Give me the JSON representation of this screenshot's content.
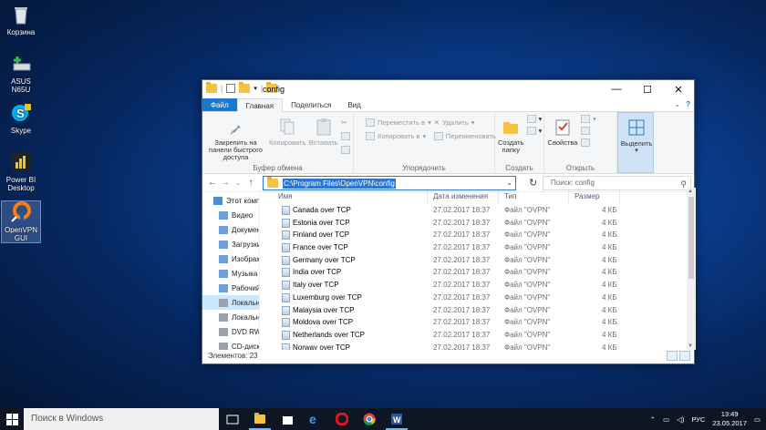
{
  "desktop": {
    "icons": [
      {
        "label": "Корзина",
        "icon": "recycle-bin-icon"
      },
      {
        "label": "ASUS N65U",
        "icon": "network-drive-icon"
      },
      {
        "label": "Skype",
        "icon": "skype-icon"
      },
      {
        "label": "Power BI Desktop",
        "icon": "power-bi-icon"
      },
      {
        "label": "OpenVPN GUI",
        "icon": "openvpn-icon"
      }
    ]
  },
  "window": {
    "title": "config",
    "minimize": "—",
    "maximize": "☐",
    "close": "✕"
  },
  "ribbon": {
    "tabs": {
      "file": "Файл",
      "home": "Главная",
      "share": "Поделиться",
      "view": "Вид"
    },
    "clipboard": {
      "pin": "Закрепить на панели быстрого доступа",
      "copy": "Копировать",
      "paste": "Вставить",
      "group": "Буфер обмена"
    },
    "organize": {
      "move_to": "Переместить в",
      "copy_to": "Копировать в",
      "delete": "Удалить",
      "rename": "Переименовать",
      "group": "Упорядочить"
    },
    "new": {
      "new_folder": "Создать папку",
      "group": "Создать"
    },
    "open": {
      "properties": "Свойства",
      "group": "Открыть"
    },
    "select": {
      "select": "Выделить"
    }
  },
  "address": {
    "path": "C:\\Program Files\\OpenVPN\\config",
    "search_placeholder": "Поиск: config"
  },
  "navpane": {
    "items": [
      {
        "label": "Этот компьютер",
        "icon": "this-pc-icon",
        "top": true
      },
      {
        "label": "Видео",
        "icon": "video-folder-icon"
      },
      {
        "label": "Документы",
        "icon": "documents-folder-icon"
      },
      {
        "label": "Загрузки",
        "icon": "downloads-folder-icon"
      },
      {
        "label": "Изображения",
        "icon": "pictures-folder-icon"
      },
      {
        "label": "Музыка",
        "icon": "music-folder-icon"
      },
      {
        "label": "Рабочий стол",
        "icon": "desktop-folder-icon"
      },
      {
        "label": "Локальный диск",
        "icon": "local-disk-icon",
        "selected": true
      },
      {
        "label": "Локальный диск",
        "icon": "local-disk-icon"
      },
      {
        "label": "DVD RW",
        "icon": "dvd-drive-icon"
      },
      {
        "label": "CD-дисковод",
        "icon": "cd-drive-icon"
      }
    ]
  },
  "columns": {
    "name": "Имя",
    "date": "Дата изменения",
    "type": "Тип",
    "size": "Размер"
  },
  "files": [
    {
      "name": "Canada over TCP",
      "date": "27.02.2017 18:37",
      "type": "Файл \"OVPN\"",
      "size": "4 КБ"
    },
    {
      "name": "Estonia over TCP",
      "date": "27.02.2017 18:37",
      "type": "Файл \"OVPN\"",
      "size": "4 КБ"
    },
    {
      "name": "Finland over TCP",
      "date": "27.02.2017 18:37",
      "type": "Файл \"OVPN\"",
      "size": "4 КБ"
    },
    {
      "name": "France over TCP",
      "date": "27.02.2017 18:37",
      "type": "Файл \"OVPN\"",
      "size": "4 КБ"
    },
    {
      "name": "Germany over TCP",
      "date": "27.02.2017 18:37",
      "type": "Файл \"OVPN\"",
      "size": "4 КБ"
    },
    {
      "name": "India over TCP",
      "date": "27.02.2017 18:37",
      "type": "Файл \"OVPN\"",
      "size": "4 КБ"
    },
    {
      "name": "Italy over TCP",
      "date": "27.02.2017 18:37",
      "type": "Файл \"OVPN\"",
      "size": "4 КБ"
    },
    {
      "name": "Luxemburg over TCP",
      "date": "27.02.2017 18:37",
      "type": "Файл \"OVPN\"",
      "size": "4 КБ"
    },
    {
      "name": "Malaysia over TCP",
      "date": "27.02.2017 18:37",
      "type": "Файл \"OVPN\"",
      "size": "4 КБ"
    },
    {
      "name": "Moldova over TCP",
      "date": "27.02.2017 18:37",
      "type": "Файл \"OVPN\"",
      "size": "4 КБ"
    },
    {
      "name": "Netherlands over TCP",
      "date": "27.02.2017 18:37",
      "type": "Файл \"OVPN\"",
      "size": "4 КБ"
    },
    {
      "name": "Norway over TCP",
      "date": "27.02.2017 18:37",
      "type": "Файл \"OVPN\"",
      "size": "4 КБ"
    }
  ],
  "status": {
    "items": "Элементов: 23"
  },
  "taskbar": {
    "search": "Поиск в Windows",
    "apps": [
      "task-view-icon",
      "file-explorer-icon",
      "store-icon",
      "edge-icon",
      "opera-icon",
      "chrome-icon",
      "word-icon"
    ],
    "lang": "РУС",
    "time": "13:49",
    "date": "23.05.2017"
  },
  "colors": {
    "accent": "#1979ca",
    "selection": "#cce8ff",
    "taskbar": "#0d1622"
  }
}
